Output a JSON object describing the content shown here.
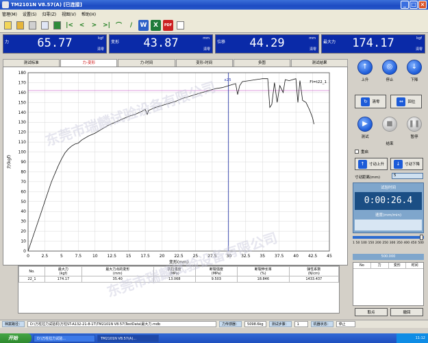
{
  "window": {
    "title": "TM2101N V8.57(A)    [已连接]"
  },
  "menu": [
    "管理(M)",
    "设置(S)",
    "归零(Z)",
    "视图(V)",
    "帮助(H)"
  ],
  "toolbar_icons": [
    "open-icon",
    "save-icon",
    "print-icon",
    "copy-icon",
    "delete-icon",
    "first-icon",
    "prev-icon",
    "next-icon",
    "last-icon",
    "curve-icon",
    "fit-icon",
    "word-icon",
    "excel-icon",
    "pdf-icon",
    "doc-icon"
  ],
  "readouts": [
    {
      "label": "力",
      "value": "65.77",
      "unit": "kgf",
      "zero": "清零"
    },
    {
      "label": "变形",
      "value": "43.87",
      "unit": "mm",
      "zero": "清零"
    },
    {
      "label": "位移",
      "value": "44.29",
      "unit": "mm",
      "zero": "清零"
    },
    {
      "label": "最大力",
      "value": "174.17",
      "unit": "kgf",
      "zero": "清零"
    }
  ],
  "tabs": [
    "测试标准",
    "力-变形",
    "力-时间",
    "变形-时间",
    "多图",
    "测试结果"
  ],
  "active_tab": 1,
  "chart_data": {
    "type": "line",
    "xlabel": "变形(mm)",
    "ylabel": "力(kgf)",
    "xlim": [
      0,
      45
    ],
    "ylim": [
      0,
      180
    ],
    "xticks": [
      "0",
      "2.5",
      "5",
      "7.5",
      "10",
      "12.5",
      "15",
      "17.5",
      "20",
      "22.5",
      "25",
      "27.5",
      "30",
      "32.5",
      "35",
      "37.5",
      "40",
      "42.5",
      "45"
    ],
    "yticks": [
      "0",
      "10",
      "20",
      "30",
      "40",
      "50",
      "60",
      "70",
      "80",
      "90",
      "100",
      "110",
      "120",
      "130",
      "140",
      "150",
      "160",
      "170",
      "180"
    ],
    "cursor_x": 29.9,
    "cursor_label": "x25",
    "ref_y": 162,
    "legend": "Fl=t22_1",
    "series": [
      {
        "x": [
          0,
          0.5,
          1,
          1.5,
          2,
          2.5,
          3,
          3.5,
          4,
          4.5,
          5,
          5.5,
          6,
          6.5,
          7,
          7.5,
          8,
          9,
          10,
          11,
          12,
          13,
          14,
          15,
          16,
          17,
          17.5,
          17.8,
          18,
          19,
          20,
          21,
          22,
          23,
          24,
          25,
          26,
          27,
          28,
          29,
          30,
          30.5,
          31,
          31.3,
          31.6,
          32,
          33,
          34,
          35,
          35.8,
          36.1,
          36.4,
          36.8,
          37.2,
          37.6,
          38.1,
          38.4,
          39,
          39.5,
          40,
          40.3,
          40.6,
          41,
          41.5,
          42,
          42.3,
          42.5,
          42.7
        ],
        "y": [
          0,
          10,
          20,
          30,
          40,
          50,
          60,
          70,
          78,
          86,
          93,
          99,
          103,
          106,
          108,
          109,
          112,
          116,
          119,
          123,
          127,
          130,
          133,
          136,
          138,
          141,
          143,
          138,
          142,
          145,
          147,
          149,
          151,
          154,
          156,
          158,
          160,
          162,
          164,
          165,
          167,
          168,
          169,
          158,
          167,
          171,
          172,
          173,
          174,
          174,
          145,
          148,
          170,
          150,
          167,
          160,
          173,
          172,
          173,
          174,
          150,
          172,
          152,
          150,
          143,
          138,
          134,
          128
        ]
      }
    ]
  },
  "results_table": {
    "headers": [
      "No.",
      "最大力\n(kgf)",
      "最大力点的变形\n(mm)",
      "抗拉强度\n(MPa)",
      "断裂强度\n(MPa)",
      "断裂伸长率\n(%)",
      "弹性系数\n(N/cm)"
    ],
    "rows": [
      [
        "22_1",
        "174.17",
        "35.40",
        "13.068",
        "9.503",
        "18.846",
        "1433.437"
      ]
    ]
  },
  "controls": {
    "up": "上升",
    "stop": "停止",
    "down": "下降",
    "zero": "清零",
    "return": "回位",
    "test": "测试",
    "end": "结束",
    "pause": "暂停",
    "reset": "重启",
    "jog_up": "寸动上升",
    "jog_down": "寸动下降",
    "jog_distance_label": "寸动距离(mm)",
    "jog_distance": "5",
    "test_time_label": "试验时间",
    "test_time": "0:00:26.4",
    "speed_label": "速度(mm/min)",
    "speed_ticks": [
      "1",
      "50",
      "100",
      "150",
      "200",
      "250",
      "300",
      "350",
      "400",
      "450",
      "500"
    ],
    "speed_value": "500.000",
    "log_headers": [
      "No",
      "力",
      "变形",
      "时间"
    ],
    "retrieve": "取点",
    "undo": "撤回"
  },
  "status": {
    "file_label": "档案路径：",
    "file_path": "D:\\万柱拉力试验机\\万柱ST-A132-21-8-1T\\TM2101N V8.57\\TestData\\最大力.mdb",
    "sensor_label": "力传感器：",
    "sensor_value": "5098.6kg",
    "step_label": "测试步骤：",
    "step_value": "1",
    "state_label": "机器状态：",
    "state_value": "停止"
  },
  "taskbar": {
    "start": "开始",
    "tasks": [
      "D:\\万柱拉力试验...",
      "TM2101N V8.57(A)..."
    ],
    "clock": "11:12"
  }
}
